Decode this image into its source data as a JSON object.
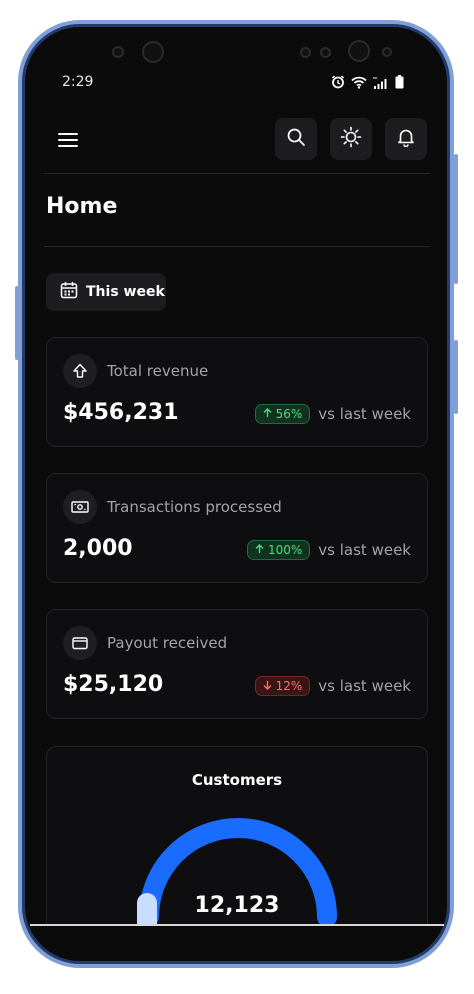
{
  "status_bar": {
    "time": "2:29"
  },
  "header": {
    "menu_icon": "hamburger-menu-icon",
    "search_icon": "search-icon",
    "theme_icon": "sun-icon",
    "notifications_icon": "bell-icon"
  },
  "page": {
    "title": "Home"
  },
  "filter": {
    "label": "This week",
    "icon": "calendar-icon"
  },
  "cards": [
    {
      "label": "Total revenue",
      "icon": "upload-arrow-icon",
      "value": "$456,231",
      "change": "56%",
      "direction": "up",
      "comparison": "vs last week"
    },
    {
      "label": "Transactions processed",
      "icon": "banknote-icon",
      "value": "2,000",
      "change": "100%",
      "direction": "up",
      "comparison": "vs last week"
    },
    {
      "label": "Payout received",
      "icon": "wallet-icon",
      "value": "$25,120",
      "change": "12%",
      "direction": "down",
      "comparison": "vs last week"
    }
  ],
  "customers": {
    "title": "Customers",
    "value": "12,123",
    "gauge_color": "#1a6bff",
    "secondary_color": "#c9ddff"
  },
  "colors": {
    "background": "#0b0b0c",
    "up": "#4ade80",
    "down": "#f87171",
    "frame": "#7f9fd6"
  }
}
